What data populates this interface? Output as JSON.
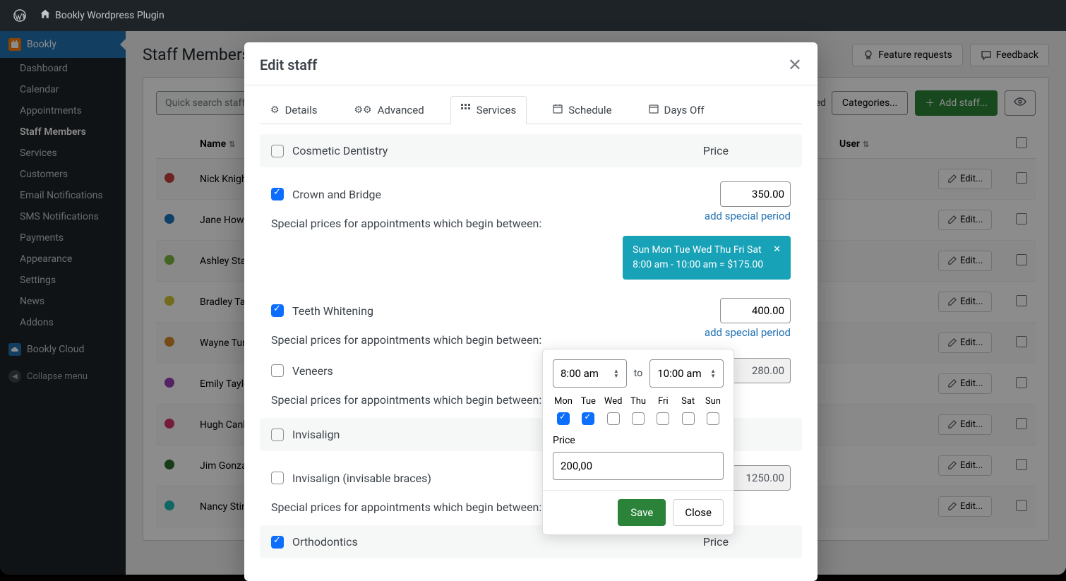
{
  "adminBar": {
    "siteName": "Bookly Wordpress Plugin"
  },
  "sidebar": {
    "pluginName": "Bookly",
    "items": [
      "Dashboard",
      "Calendar",
      "Appointments",
      "Staff Members",
      "Services",
      "Customers",
      "Email Notifications",
      "SMS Notifications",
      "Payments",
      "Appearance",
      "Settings",
      "News",
      "Addons"
    ],
    "activeItem": "Staff Members",
    "cloudLabel": "Bookly Cloud",
    "collapseLabel": "Collapse menu"
  },
  "page": {
    "title": "Staff Members",
    "featureRequests": "Feature requests",
    "feedback": "Feedback",
    "searchPlaceholder": "Quick search staff",
    "categoriesLabel": "Categories...",
    "addStaff": "Add staff...",
    "selectedText": "selected"
  },
  "table": {
    "columns": {
      "name": "Name",
      "user": "User",
      "edit": "Edit..."
    },
    "rows": [
      {
        "color": "#c94040",
        "name": "Nick Knight"
      },
      {
        "color": "#1e73be",
        "name": "Jane Howard"
      },
      {
        "color": "#7db742",
        "name": "Ashley Stamp"
      },
      {
        "color": "#d4c536",
        "name": "Bradley Tanner"
      },
      {
        "color": "#d68b2b",
        "name": "Wayne Turner"
      },
      {
        "color": "#9b3fb5",
        "name": "Emily Taylor"
      },
      {
        "color": "#d6336c",
        "name": "Hugh Canberg"
      },
      {
        "color": "#2a6e2a",
        "name": "Jim Gonzalez"
      },
      {
        "color": "#1dbab4",
        "name": "Nancy Stinson"
      }
    ]
  },
  "modal": {
    "title": "Edit staff",
    "tabs": {
      "details": "Details",
      "advanced": "Advanced",
      "services": "Services",
      "schedule": "Schedule",
      "daysoff": "Days Off"
    },
    "category": {
      "name": "Cosmetic Dentistry",
      "priceLabel": "Price"
    },
    "specialPriceText": "Special prices for appointments which begin between:",
    "addSpecial": "add special period",
    "services": {
      "crown": {
        "name": "Crown and Bridge",
        "price": "350.00",
        "checked": true,
        "badge": {
          "days": "Sun Mon Tue Wed Thu Fri Sat",
          "range": "8:00 am - 10:00 am = $175.00"
        }
      },
      "teeth": {
        "name": "Teeth Whitening",
        "price": "400.00",
        "checked": true
      },
      "veneers": {
        "name": "Veneers",
        "price": "280.00",
        "checked": false,
        "readonly": true
      }
    },
    "category2": {
      "name": "Invisalign",
      "priceLabel": "Price"
    },
    "services2": {
      "invisalign": {
        "name": "Invisalign (invisable braces)",
        "price": "1250.00",
        "checked": false,
        "readonly": true
      }
    },
    "category3": {
      "name": "Orthodontics",
      "priceLabel": "Price"
    }
  },
  "popover": {
    "startTime": "8:00 am",
    "toLabel": "to",
    "endTime": "10:00 am",
    "days": [
      "Mon",
      "Tue",
      "Wed",
      "Thu",
      "Fri",
      "Sat",
      "Sun"
    ],
    "checked": [
      true,
      true,
      false,
      false,
      false,
      false,
      false
    ],
    "priceLabel": "Price",
    "priceValue": "200,00",
    "save": "Save",
    "close": "Close"
  }
}
